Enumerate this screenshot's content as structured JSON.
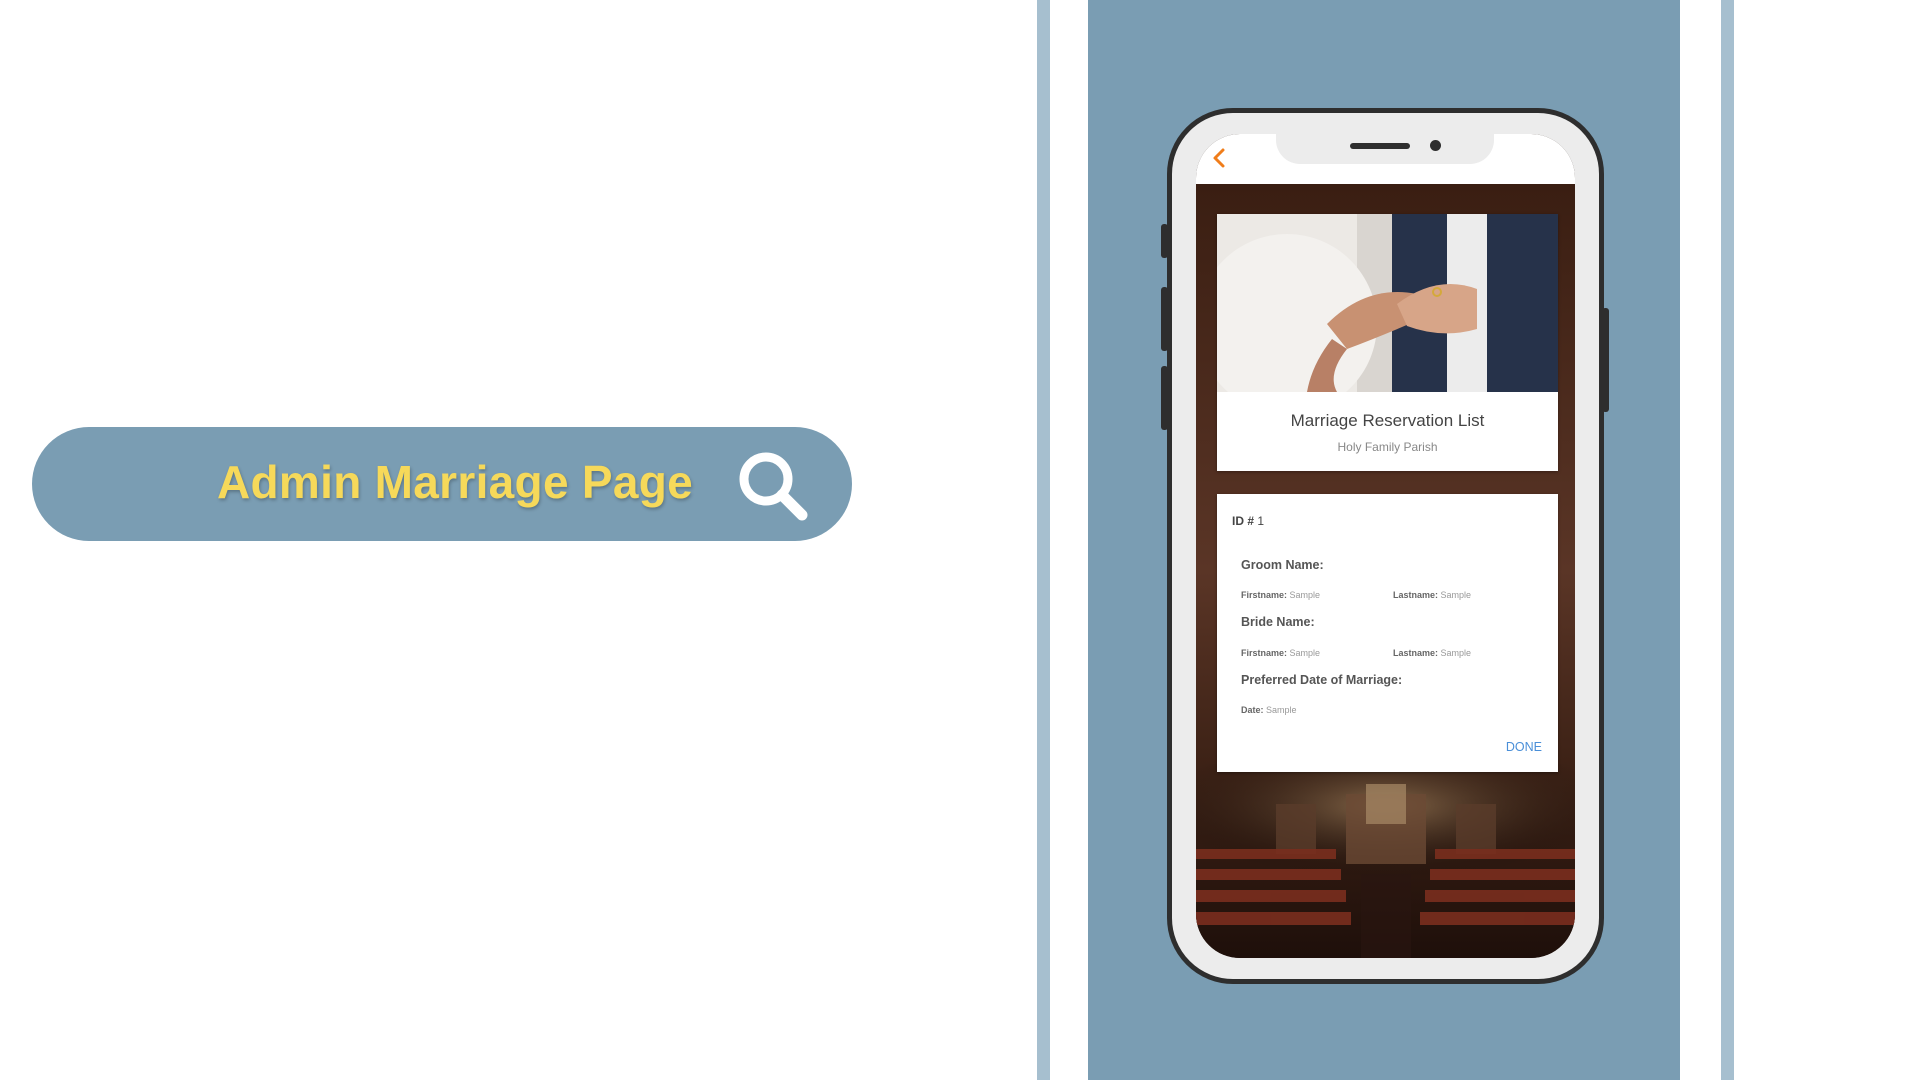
{
  "banner": {
    "title": "Admin Marriage Page",
    "icon": "search-icon",
    "title_color": "#f6d95a",
    "background": "#7a9db3"
  },
  "phone": {
    "back_icon": "chevron-left-icon",
    "header_card": {
      "title": "Marriage Reservation List",
      "subtitle": "Holy Family Parish"
    },
    "record": {
      "id_label": "ID",
      "id_hash": "#",
      "id_value": "1",
      "groom_heading": "Groom Name:",
      "groom_firstname_label": "Firstname:",
      "groom_firstname_value": "Sample",
      "groom_lastname_label": "Lastname:",
      "groom_lastname_value": "Sample",
      "bride_heading": "Bride Name:",
      "bride_firstname_label": "Firstname:",
      "bride_firstname_value": "Sample",
      "bride_lastname_label": "Lastname:",
      "bride_lastname_value": "Sample",
      "date_heading": "Preferred Date of Marriage:",
      "date_label": "Date:",
      "date_value": "Sample",
      "done_label": "DONE"
    }
  }
}
